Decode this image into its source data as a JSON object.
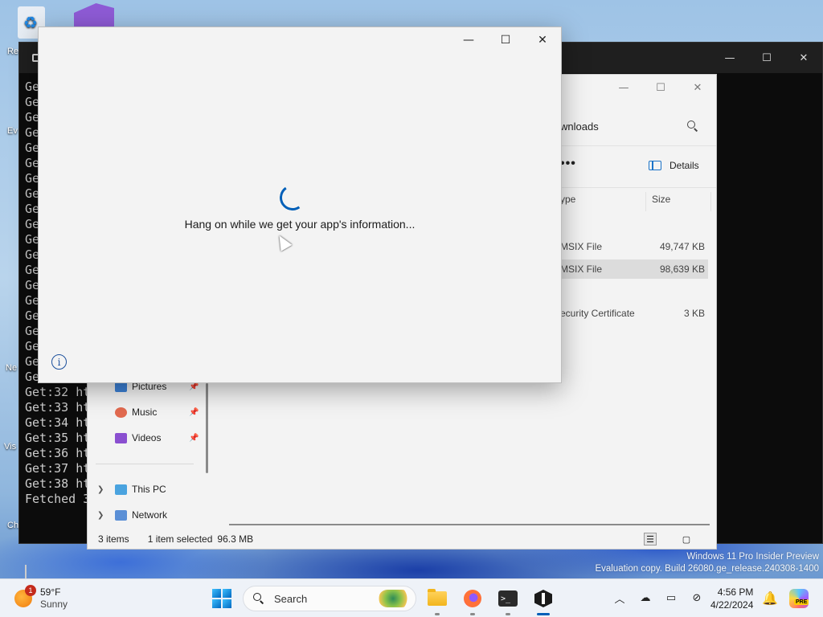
{
  "desktop": {
    "recycle_label": "Re",
    "side_labels": [
      "Ev",
      "Ne",
      "Vis",
      "Ch"
    ]
  },
  "terminal": {
    "lines": [
      "Ge",
      "Ge",
      "Ge",
      "Ge",
      "Ge",
      "Ge",
      "Ge",
      "Ge",
      "Ge",
      "Ge",
      "Ge",
      "Ge",
      "Ge",
      "Ge",
      "Ge",
      "Ge",
      "Ge",
      "Ge",
      "Ge",
      "Get:31 ht",
      "Get:32 ht",
      "Get:33 ht",
      "Get:34 ht",
      "Get:35 ht",
      "Get:36 ht",
      "Get:37 ht",
      "Get:38 ht",
      "Fetched 3"
    ],
    "controls": [
      "—",
      "☐",
      "✕"
    ]
  },
  "explorer": {
    "search_text": "wnloads",
    "more_label": "•••",
    "details_label": "Details",
    "columns": {
      "type": "ype",
      "size": "Size"
    },
    "files": [
      {
        "type": "MSIX File",
        "size": "49,747 KB",
        "selected": false
      },
      {
        "type": "MSIX File",
        "size": "98,639 KB",
        "selected": true
      },
      {
        "type": "ecurity Certificate",
        "size": "3 KB",
        "selected": false
      }
    ],
    "nav": {
      "pictures": "Pictures",
      "music": "Music",
      "videos": "Videos",
      "this_pc": "This PC",
      "network": "Network"
    },
    "status": {
      "items": "3 items",
      "selected": "1 item selected",
      "size": "96.3 MB"
    },
    "controls": [
      "—",
      "☐",
      "✕"
    ]
  },
  "dialog": {
    "message": "Hang on while we get your app's information...",
    "info_glyph": "i",
    "controls": [
      "—",
      "☐",
      "✕"
    ]
  },
  "watermark": {
    "line1": "Windows 11 Pro Insider Preview",
    "line2": "Evaluation copy. Build 26080.ge_release.240308-1400"
  },
  "taskbar": {
    "weather": {
      "temp": "59°F",
      "condition": "Sunny",
      "badge": "1"
    },
    "search_placeholder": "Search",
    "clock": {
      "time": "4:56 PM",
      "date": "4/22/2024"
    },
    "copilot_tag": "PRE",
    "tray_icons": [
      "chevron-up-icon",
      "onedrive-icon",
      "display-icon",
      "network-icon"
    ]
  },
  "colors": {
    "accent": "#005fb8",
    "selection": "#dcdcdc",
    "dialog_bg": "#f3f3f3",
    "terminal_bg": "#0c0c0c"
  }
}
